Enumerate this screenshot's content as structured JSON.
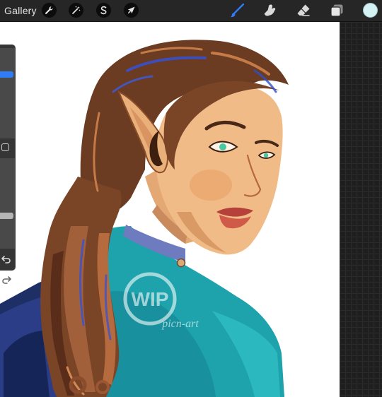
{
  "toolbar": {
    "gallery_label": "Gallery",
    "left_tools": [
      {
        "name": "actions",
        "icon": "wrench-icon"
      },
      {
        "name": "adjustments",
        "icon": "magic-wand-icon"
      },
      {
        "name": "selection",
        "icon": "selection-s-icon"
      },
      {
        "name": "transform",
        "icon": "arrow-cursor-icon"
      }
    ],
    "right_tools": [
      {
        "name": "brush",
        "icon": "brush-icon",
        "active": true
      },
      {
        "name": "smudge",
        "icon": "smudge-finger-icon",
        "active": false
      },
      {
        "name": "eraser",
        "icon": "eraser-icon",
        "active": false
      },
      {
        "name": "layers",
        "icon": "layers-icon",
        "active": false
      }
    ],
    "current_color": "#d4f1f4"
  },
  "sidebar": {
    "brush_size_level": 0.72,
    "opacity_level": 0.35,
    "icons": [
      "undo-icon",
      "redo-icon"
    ]
  },
  "canvas": {
    "watermark": {
      "badge_text": "WIP",
      "signature_text": "picn-art"
    }
  },
  "colors": {
    "accent": "#2f7cf6",
    "ui_dark": "#262626",
    "canvas_bg": "#ffffff"
  }
}
